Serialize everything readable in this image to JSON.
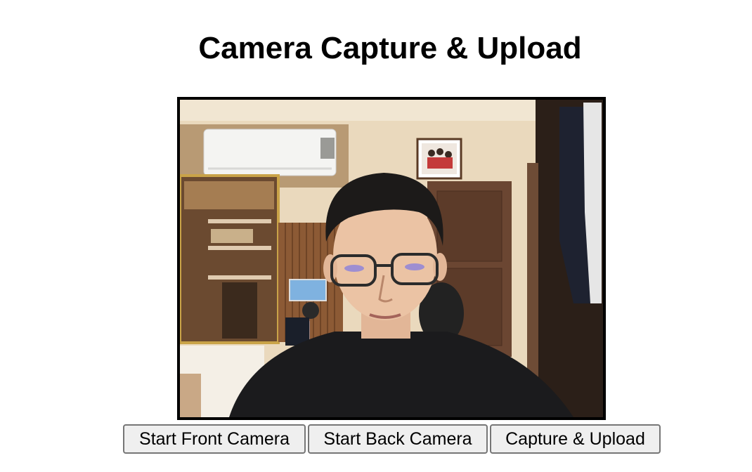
{
  "page": {
    "title": "Camera Capture & Upload"
  },
  "video": {
    "description_icon": "camera-feed"
  },
  "controls": {
    "start_front_label": "Start Front Camera",
    "start_back_label": "Start Back Camera",
    "capture_upload_label": "Capture & Upload"
  },
  "colors": {
    "button_bg": "#efefef",
    "button_border": "#767676",
    "frame_border": "#000000"
  }
}
